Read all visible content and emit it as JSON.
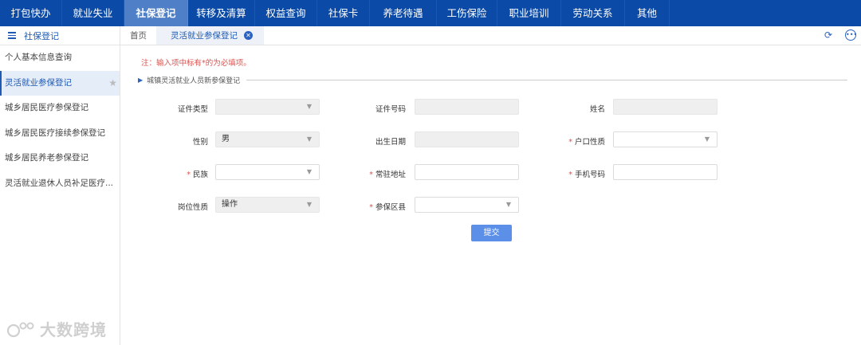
{
  "topnav": {
    "items": [
      {
        "label": "打包快办"
      },
      {
        "label": "就业失业"
      },
      {
        "label": "社保登记"
      },
      {
        "label": "转移及清算"
      },
      {
        "label": "权益查询"
      },
      {
        "label": "社保卡"
      },
      {
        "label": "养老待遇"
      },
      {
        "label": "工伤保险"
      },
      {
        "label": "职业培训"
      },
      {
        "label": "劳动关系"
      },
      {
        "label": "其他"
      }
    ],
    "active_index": 2
  },
  "sidebar": {
    "title": "社保登记",
    "items": [
      {
        "label": "个人基本信息查询"
      },
      {
        "label": "灵活就业参保登记"
      },
      {
        "label": "城乡居民医疗参保登记"
      },
      {
        "label": "城乡居民医疗接续参保登记"
      },
      {
        "label": "城乡居民养老参保登记"
      },
      {
        "label": "灵活就业退休人员补足医疗..."
      }
    ]
  },
  "tabs": {
    "home": "首页",
    "active": "灵活就业参保登记"
  },
  "form": {
    "notice": "注：输入项中标有*的为必填项。",
    "section_title": "城镇灵活就业人员新参保登记",
    "fields": {
      "id_type": {
        "label": "证件类型",
        "value": ""
      },
      "id_number": {
        "label": "证件号码",
        "value": ""
      },
      "name": {
        "label": "姓名",
        "value": ""
      },
      "gender": {
        "label": "性别",
        "value": "男"
      },
      "birth_date": {
        "label": "出生日期",
        "value": ""
      },
      "household_type": {
        "label": "户口性质",
        "value": ""
      },
      "ethnicity": {
        "label": "民族",
        "value": ""
      },
      "address": {
        "label": "常驻地址",
        "value": ""
      },
      "phone": {
        "label": "手机号码",
        "value": ""
      },
      "job_type": {
        "label": "岗位性质",
        "value": "操作"
      },
      "district": {
        "label": "参保区县",
        "value": ""
      }
    },
    "required_mark": "*",
    "submit_label": "提交"
  },
  "watermark": {
    "text": "大数跨境"
  },
  "colors": {
    "nav_bg": "#0b4aa6",
    "nav_active": "#4f7fc6",
    "accent": "#1f5bb5",
    "required": "#d9534f",
    "button": "#5b8fe8"
  }
}
